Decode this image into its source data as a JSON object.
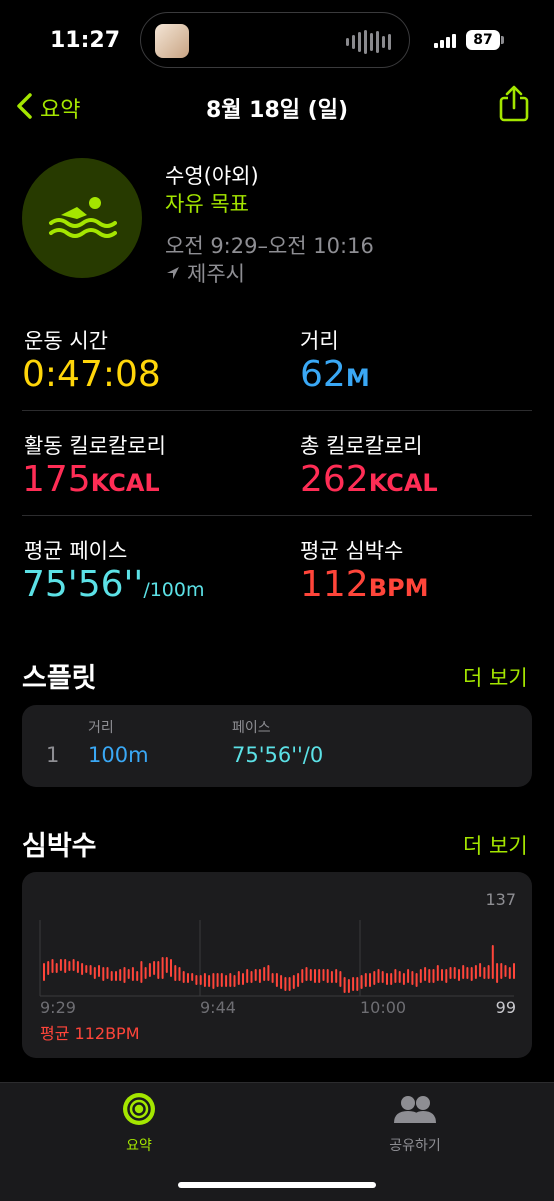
{
  "status_bar": {
    "time": "11:27",
    "battery": "87"
  },
  "nav": {
    "back_label": "요약",
    "title": "8월 18일 (일)"
  },
  "workout": {
    "type": "수영(야외)",
    "goal": "자유 목표",
    "time_range": "오전 9:29–오전 10:16",
    "location": "제주시",
    "icon": "swimmer-icon"
  },
  "metrics": {
    "duration": {
      "label": "운동 시간",
      "value": "0:47:08"
    },
    "distance": {
      "label": "거리",
      "value": "62",
      "unit": "M"
    },
    "active_cal": {
      "label": "활동 킬로칼로리",
      "value": "175",
      "unit": "KCAL"
    },
    "total_cal": {
      "label": "총 킬로칼로리",
      "value": "262",
      "unit": "KCAL"
    },
    "avg_pace": {
      "label": "평균 페이스",
      "value": "75'56''",
      "unit": "/100m"
    },
    "avg_hr": {
      "label": "평균 심박수",
      "value": "112",
      "unit": "BPM"
    }
  },
  "splits": {
    "title": "스플릿",
    "more": "더 보기",
    "headers": {
      "distance": "거리",
      "pace": "페이스"
    },
    "rows": [
      {
        "index": "1",
        "distance": "100m",
        "pace": "75'56''/0"
      }
    ]
  },
  "heart_rate": {
    "title": "심박수",
    "more": "더 보기",
    "max_label": "137",
    "min_label": "99",
    "time_labels": [
      "9:29",
      "9:44",
      "10:00"
    ],
    "avg_label": "평균 112BPM"
  },
  "chart_data": {
    "type": "bar",
    "title": "",
    "ylim": [
      99,
      137
    ],
    "x": [
      "9:29",
      "9:44",
      "10:00"
    ],
    "series": [
      {
        "values": [
          [
            107,
            115
          ],
          [
            110,
            116
          ],
          [
            111,
            117
          ],
          [
            111,
            115
          ],
          [
            112,
            117
          ],
          [
            111,
            117
          ],
          [
            112,
            116
          ],
          [
            112,
            117
          ],
          [
            111,
            116
          ],
          [
            110,
            115
          ],
          [
            111,
            114
          ],
          [
            110,
            114
          ],
          [
            108,
            113
          ],
          [
            109,
            114
          ],
          [
            107,
            113
          ],
          [
            108,
            113
          ],
          [
            107,
            111
          ],
          [
            107,
            111
          ],
          [
            107,
            112
          ],
          [
            106,
            113
          ],
          [
            108,
            112
          ],
          [
            107,
            113
          ],
          [
            107,
            111
          ],
          [
            106,
            116
          ],
          [
            108,
            113
          ],
          [
            109,
            115
          ],
          [
            110,
            116
          ],
          [
            108,
            116
          ],
          [
            108,
            118
          ],
          [
            111,
            118
          ],
          [
            109,
            117
          ],
          [
            107,
            114
          ],
          [
            107,
            113
          ],
          [
            106,
            111
          ],
          [
            106,
            110
          ],
          [
            107,
            110
          ],
          [
            105,
            109
          ],
          [
            105,
            109
          ],
          [
            104,
            110
          ],
          [
            104,
            109
          ],
          [
            103,
            110
          ],
          [
            104,
            110
          ],
          [
            104,
            110
          ],
          [
            104,
            109
          ],
          [
            104,
            110
          ],
          [
            104,
            109
          ],
          [
            105,
            111
          ],
          [
            105,
            110
          ],
          [
            106,
            112
          ],
          [
            106,
            111
          ],
          [
            107,
            112
          ],
          [
            106,
            112
          ],
          [
            107,
            113
          ],
          [
            107,
            114
          ],
          [
            106,
            110
          ],
          [
            104,
            110
          ],
          [
            103,
            109
          ],
          [
            102,
            108
          ],
          [
            102,
            108
          ],
          [
            103,
            109
          ],
          [
            104,
            110
          ],
          [
            106,
            112
          ],
          [
            107,
            113
          ],
          [
            107,
            112
          ],
          [
            106,
            112
          ],
          [
            106,
            112
          ],
          [
            107,
            112
          ],
          [
            106,
            112
          ],
          [
            106,
            111
          ],
          [
            106,
            112
          ],
          [
            104,
            111
          ],
          [
            101,
            108
          ],
          [
            101,
            107
          ],
          [
            102,
            108
          ],
          [
            102,
            108
          ],
          [
            103,
            109
          ],
          [
            104,
            110
          ],
          [
            104,
            110
          ],
          [
            105,
            111
          ],
          [
            106,
            112
          ],
          [
            106,
            111
          ],
          [
            105,
            110
          ],
          [
            105,
            110
          ],
          [
            106,
            112
          ],
          [
            106,
            111
          ],
          [
            105,
            110
          ],
          [
            106,
            112
          ],
          [
            105,
            111
          ],
          [
            104,
            110
          ],
          [
            106,
            112
          ],
          [
            107,
            113
          ],
          [
            106,
            112
          ],
          [
            106,
            112
          ],
          [
            107,
            114
          ],
          [
            107,
            112
          ],
          [
            106,
            112
          ],
          [
            108,
            113
          ],
          [
            108,
            113
          ],
          [
            107,
            112
          ],
          [
            108,
            114
          ],
          [
            108,
            113
          ],
          [
            107,
            113
          ],
          [
            108,
            114
          ],
          [
            109,
            115
          ],
          [
            108,
            113
          ],
          [
            108,
            114
          ],
          [
            108,
            124
          ],
          [
            106,
            115
          ],
          [
            108,
            115
          ],
          [
            109,
            114
          ],
          [
            108,
            113
          ],
          [
            108,
            115
          ]
        ]
      }
    ]
  },
  "tabbar": {
    "summary": "요약",
    "sharing": "공유하기"
  },
  "colors": {
    "accent": "#a4e600",
    "duration": "#ffd60a",
    "distance": "#3aa8f5",
    "calories": "#ff2d55",
    "pace": "#5ce1e6",
    "heart": "#ff453a"
  }
}
